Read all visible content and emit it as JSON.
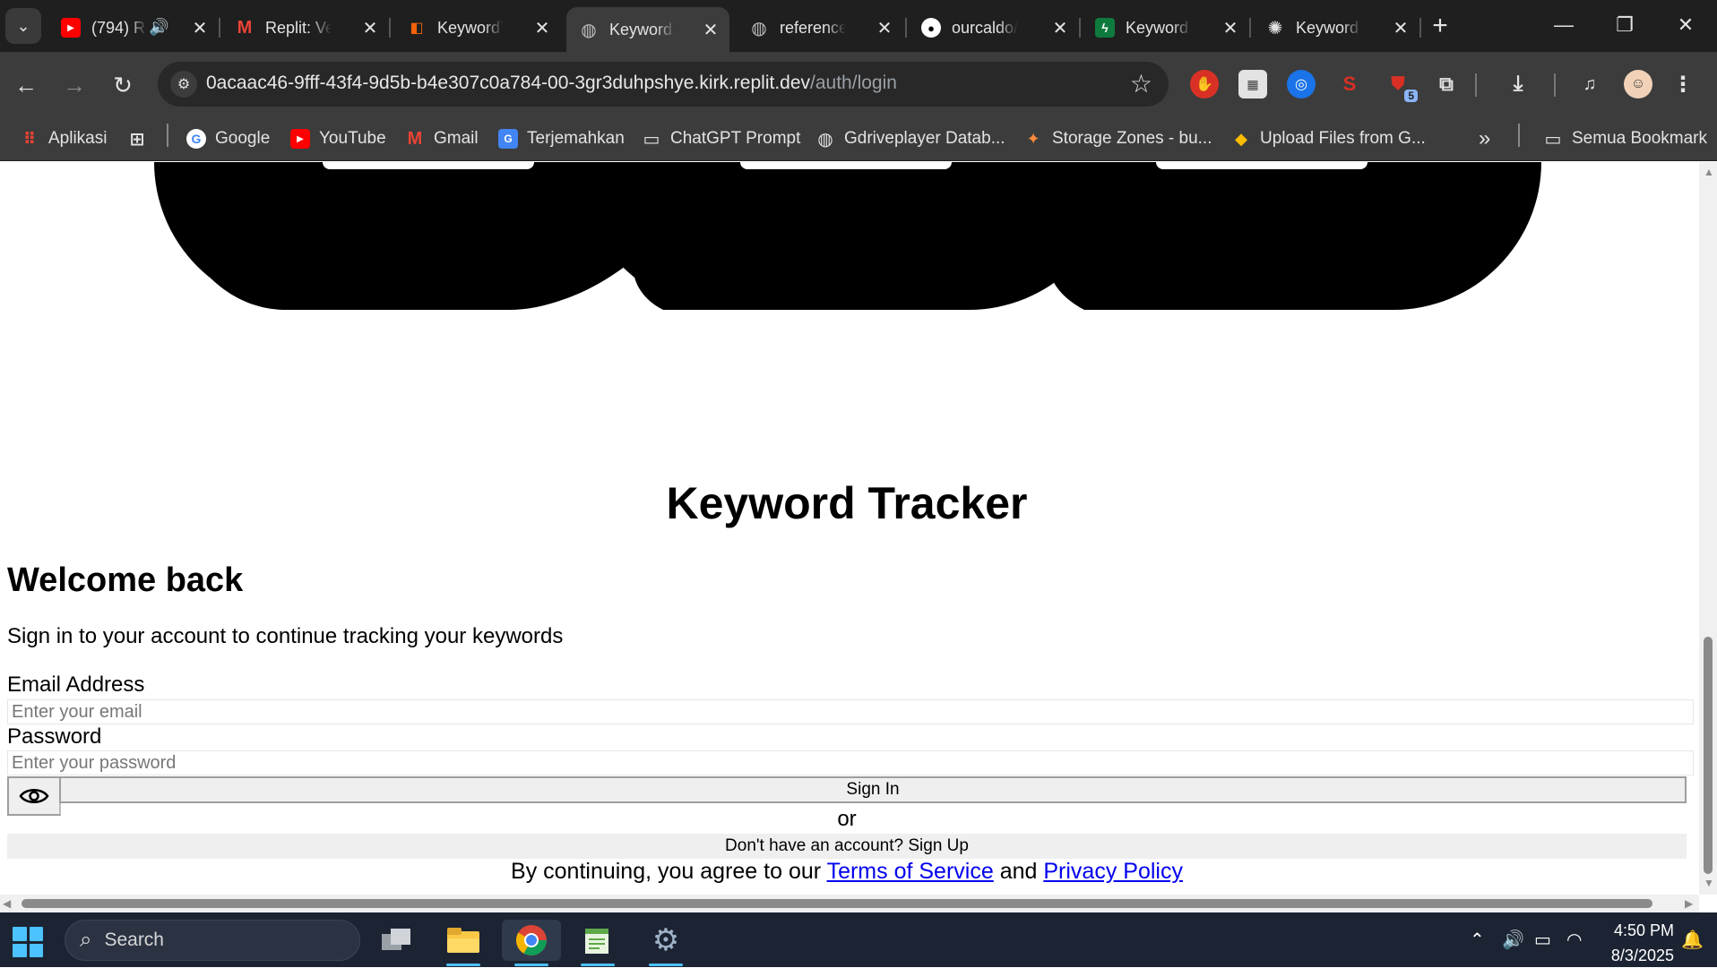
{
  "browser": {
    "tabs": [
      {
        "title": "(794) R",
        "favicon": "youtube-icon",
        "audio": true
      },
      {
        "title": "Replit: Veri",
        "favicon": "gmail-icon"
      },
      {
        "title": "KeywordTr",
        "favicon": "replit-icon"
      },
      {
        "title": "Keyword Tr",
        "favicon": "globe-icon",
        "active": true
      },
      {
        "title": "reference f",
        "favicon": "globe-icon"
      },
      {
        "title": "ourcaldo/k",
        "favicon": "github-icon"
      },
      {
        "title": "Keyword T",
        "favicon": "bolt-icon"
      },
      {
        "title": "Keyword tr",
        "favicon": "openai-icon"
      }
    ],
    "url_host": "0acaac46-9fff-43f4-9d5b-b4e307c0a784-00-3gr3duhpshye.kirk.replit.dev",
    "url_path": "/auth/login",
    "extension_badge": "5",
    "bookmarks": [
      {
        "label": "Aplikasi",
        "icon": "apps-grid-icon"
      },
      {
        "label": "Google",
        "icon": "google-icon"
      },
      {
        "label": "YouTube",
        "icon": "youtube-icon"
      },
      {
        "label": "Gmail",
        "icon": "gmail-icon"
      },
      {
        "label": "Terjemahkan",
        "icon": "translate-icon"
      },
      {
        "label": "ChatGPT Prompt",
        "icon": "folder-icon"
      },
      {
        "label": "Gdriveplayer Datab...",
        "icon": "globe-icon"
      },
      {
        "label": "Storage Zones - bu...",
        "icon": "bunny-icon"
      },
      {
        "label": "Upload Files from G...",
        "icon": "box-icon"
      }
    ],
    "all_bookmarks": "Semua Bookmark",
    "overflow": "»"
  },
  "page": {
    "app_title": "Keyword Tracker",
    "heading": "Welcome back",
    "subtitle": "Sign in to your account to continue tracking your keywords",
    "email_label": "Email Address",
    "email_placeholder": "Enter your email",
    "password_label": "Password",
    "password_placeholder": "Enter your password",
    "sign_in": "Sign In",
    "or": "or",
    "sign_up": "Don't have an account? Sign Up",
    "terms_prefix": "By continuing, you agree to our",
    "terms_link": "Terms of Service",
    "terms_and": "and",
    "privacy_link": "Privacy Policy"
  },
  "taskbar": {
    "search_label": "Search",
    "time": "4:50 PM",
    "date": "8/3/2025"
  },
  "colors": {
    "chrome_dark": "#1f1f1f",
    "toolbar": "#3c3c3c",
    "link": "#0000ee",
    "taskbar": "#1c2433",
    "accent": "#4cc2ff"
  }
}
